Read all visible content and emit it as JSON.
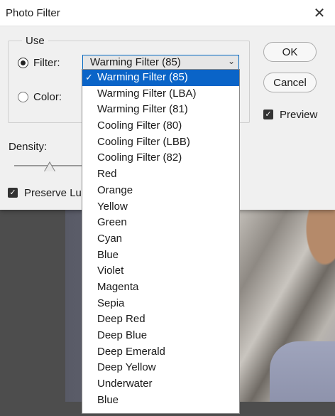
{
  "window": {
    "title": "Photo Filter"
  },
  "use_group": {
    "label": "Use"
  },
  "filter_option": {
    "label": "Filter:",
    "selected_value": "Warming Filter (85)"
  },
  "color_option": {
    "label": "Color:"
  },
  "buttons": {
    "ok": "OK",
    "cancel": "Cancel"
  },
  "preview": {
    "label": "Preview",
    "checked": true
  },
  "density": {
    "label": "Density:"
  },
  "preserve": {
    "label": "Preserve Lur",
    "checked": true
  },
  "dropdown": {
    "items": [
      "Warming Filter (85)",
      "Warming Filter (LBA)",
      "Warming Filter (81)",
      "Cooling Filter (80)",
      "Cooling Filter (LBB)",
      "Cooling Filter (82)",
      "Red",
      "Orange",
      "Yellow",
      "Green",
      "Cyan",
      "Blue",
      "Violet",
      "Magenta",
      "Sepia",
      "Deep Red",
      "Deep Blue",
      "Deep Emerald",
      "Deep Yellow",
      "Underwater",
      "Blue"
    ],
    "selected_index": 0
  },
  "icons": {
    "close": "close-icon",
    "check": "checkmark-icon",
    "chevron": "chevron-down-icon"
  },
  "colors": {
    "accent": "#0a64c8",
    "dialog_bg": "#f0f0f0"
  }
}
